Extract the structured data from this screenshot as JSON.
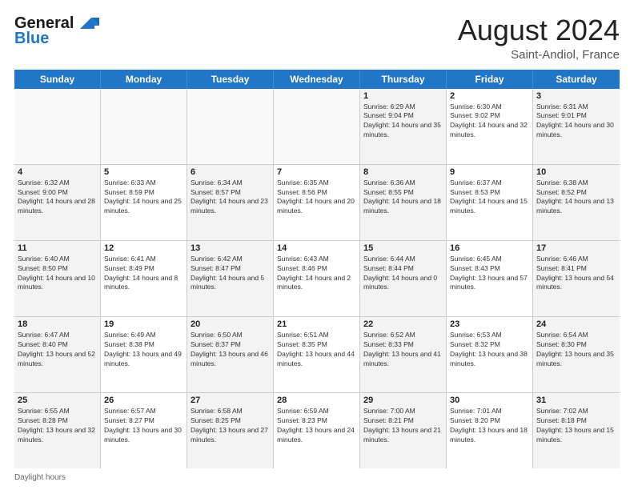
{
  "header": {
    "logo_line1": "General",
    "logo_line2": "Blue",
    "month_title": "August 2024",
    "location": "Saint-Andiol, France"
  },
  "days_of_week": [
    "Sunday",
    "Monday",
    "Tuesday",
    "Wednesday",
    "Thursday",
    "Friday",
    "Saturday"
  ],
  "footer_label": "Daylight hours",
  "weeks": [
    [
      {
        "day": "",
        "empty": true
      },
      {
        "day": "",
        "empty": true
      },
      {
        "day": "",
        "empty": true
      },
      {
        "day": "",
        "empty": true
      },
      {
        "day": "1",
        "sunrise": "Sunrise: 6:29 AM",
        "sunset": "Sunset: 9:04 PM",
        "daylight": "Daylight: 14 hours and 35 minutes."
      },
      {
        "day": "2",
        "sunrise": "Sunrise: 6:30 AM",
        "sunset": "Sunset: 9:02 PM",
        "daylight": "Daylight: 14 hours and 32 minutes."
      },
      {
        "day": "3",
        "sunrise": "Sunrise: 6:31 AM",
        "sunset": "Sunset: 9:01 PM",
        "daylight": "Daylight: 14 hours and 30 minutes."
      }
    ],
    [
      {
        "day": "4",
        "sunrise": "Sunrise: 6:32 AM",
        "sunset": "Sunset: 9:00 PM",
        "daylight": "Daylight: 14 hours and 28 minutes."
      },
      {
        "day": "5",
        "sunrise": "Sunrise: 6:33 AM",
        "sunset": "Sunset: 8:59 PM",
        "daylight": "Daylight: 14 hours and 25 minutes."
      },
      {
        "day": "6",
        "sunrise": "Sunrise: 6:34 AM",
        "sunset": "Sunset: 8:57 PM",
        "daylight": "Daylight: 14 hours and 23 minutes."
      },
      {
        "day": "7",
        "sunrise": "Sunrise: 6:35 AM",
        "sunset": "Sunset: 8:56 PM",
        "daylight": "Daylight: 14 hours and 20 minutes."
      },
      {
        "day": "8",
        "sunrise": "Sunrise: 6:36 AM",
        "sunset": "Sunset: 8:55 PM",
        "daylight": "Daylight: 14 hours and 18 minutes."
      },
      {
        "day": "9",
        "sunrise": "Sunrise: 6:37 AM",
        "sunset": "Sunset: 8:53 PM",
        "daylight": "Daylight: 14 hours and 15 minutes."
      },
      {
        "day": "10",
        "sunrise": "Sunrise: 6:38 AM",
        "sunset": "Sunset: 8:52 PM",
        "daylight": "Daylight: 14 hours and 13 minutes."
      }
    ],
    [
      {
        "day": "11",
        "sunrise": "Sunrise: 6:40 AM",
        "sunset": "Sunset: 8:50 PM",
        "daylight": "Daylight: 14 hours and 10 minutes."
      },
      {
        "day": "12",
        "sunrise": "Sunrise: 6:41 AM",
        "sunset": "Sunset: 8:49 PM",
        "daylight": "Daylight: 14 hours and 8 minutes."
      },
      {
        "day": "13",
        "sunrise": "Sunrise: 6:42 AM",
        "sunset": "Sunset: 8:47 PM",
        "daylight": "Daylight: 14 hours and 5 minutes."
      },
      {
        "day": "14",
        "sunrise": "Sunrise: 6:43 AM",
        "sunset": "Sunset: 8:46 PM",
        "daylight": "Daylight: 14 hours and 2 minutes."
      },
      {
        "day": "15",
        "sunrise": "Sunrise: 6:44 AM",
        "sunset": "Sunset: 8:44 PM",
        "daylight": "Daylight: 14 hours and 0 minutes."
      },
      {
        "day": "16",
        "sunrise": "Sunrise: 6:45 AM",
        "sunset": "Sunset: 8:43 PM",
        "daylight": "Daylight: 13 hours and 57 minutes."
      },
      {
        "day": "17",
        "sunrise": "Sunrise: 6:46 AM",
        "sunset": "Sunset: 8:41 PM",
        "daylight": "Daylight: 13 hours and 54 minutes."
      }
    ],
    [
      {
        "day": "18",
        "sunrise": "Sunrise: 6:47 AM",
        "sunset": "Sunset: 8:40 PM",
        "daylight": "Daylight: 13 hours and 52 minutes."
      },
      {
        "day": "19",
        "sunrise": "Sunrise: 6:49 AM",
        "sunset": "Sunset: 8:38 PM",
        "daylight": "Daylight: 13 hours and 49 minutes."
      },
      {
        "day": "20",
        "sunrise": "Sunrise: 6:50 AM",
        "sunset": "Sunset: 8:37 PM",
        "daylight": "Daylight: 13 hours and 46 minutes."
      },
      {
        "day": "21",
        "sunrise": "Sunrise: 6:51 AM",
        "sunset": "Sunset: 8:35 PM",
        "daylight": "Daylight: 13 hours and 44 minutes."
      },
      {
        "day": "22",
        "sunrise": "Sunrise: 6:52 AM",
        "sunset": "Sunset: 8:33 PM",
        "daylight": "Daylight: 13 hours and 41 minutes."
      },
      {
        "day": "23",
        "sunrise": "Sunrise: 6:53 AM",
        "sunset": "Sunset: 8:32 PM",
        "daylight": "Daylight: 13 hours and 38 minutes."
      },
      {
        "day": "24",
        "sunrise": "Sunrise: 6:54 AM",
        "sunset": "Sunset: 8:30 PM",
        "daylight": "Daylight: 13 hours and 35 minutes."
      }
    ],
    [
      {
        "day": "25",
        "sunrise": "Sunrise: 6:55 AM",
        "sunset": "Sunset: 8:28 PM",
        "daylight": "Daylight: 13 hours and 32 minutes."
      },
      {
        "day": "26",
        "sunrise": "Sunrise: 6:57 AM",
        "sunset": "Sunset: 8:27 PM",
        "daylight": "Daylight: 13 hours and 30 minutes."
      },
      {
        "day": "27",
        "sunrise": "Sunrise: 6:58 AM",
        "sunset": "Sunset: 8:25 PM",
        "daylight": "Daylight: 13 hours and 27 minutes."
      },
      {
        "day": "28",
        "sunrise": "Sunrise: 6:59 AM",
        "sunset": "Sunset: 8:23 PM",
        "daylight": "Daylight: 13 hours and 24 minutes."
      },
      {
        "day": "29",
        "sunrise": "Sunrise: 7:00 AM",
        "sunset": "Sunset: 8:21 PM",
        "daylight": "Daylight: 13 hours and 21 minutes."
      },
      {
        "day": "30",
        "sunrise": "Sunrise: 7:01 AM",
        "sunset": "Sunset: 8:20 PM",
        "daylight": "Daylight: 13 hours and 18 minutes."
      },
      {
        "day": "31",
        "sunrise": "Sunrise: 7:02 AM",
        "sunset": "Sunset: 8:18 PM",
        "daylight": "Daylight: 13 hours and 15 minutes."
      }
    ]
  ]
}
